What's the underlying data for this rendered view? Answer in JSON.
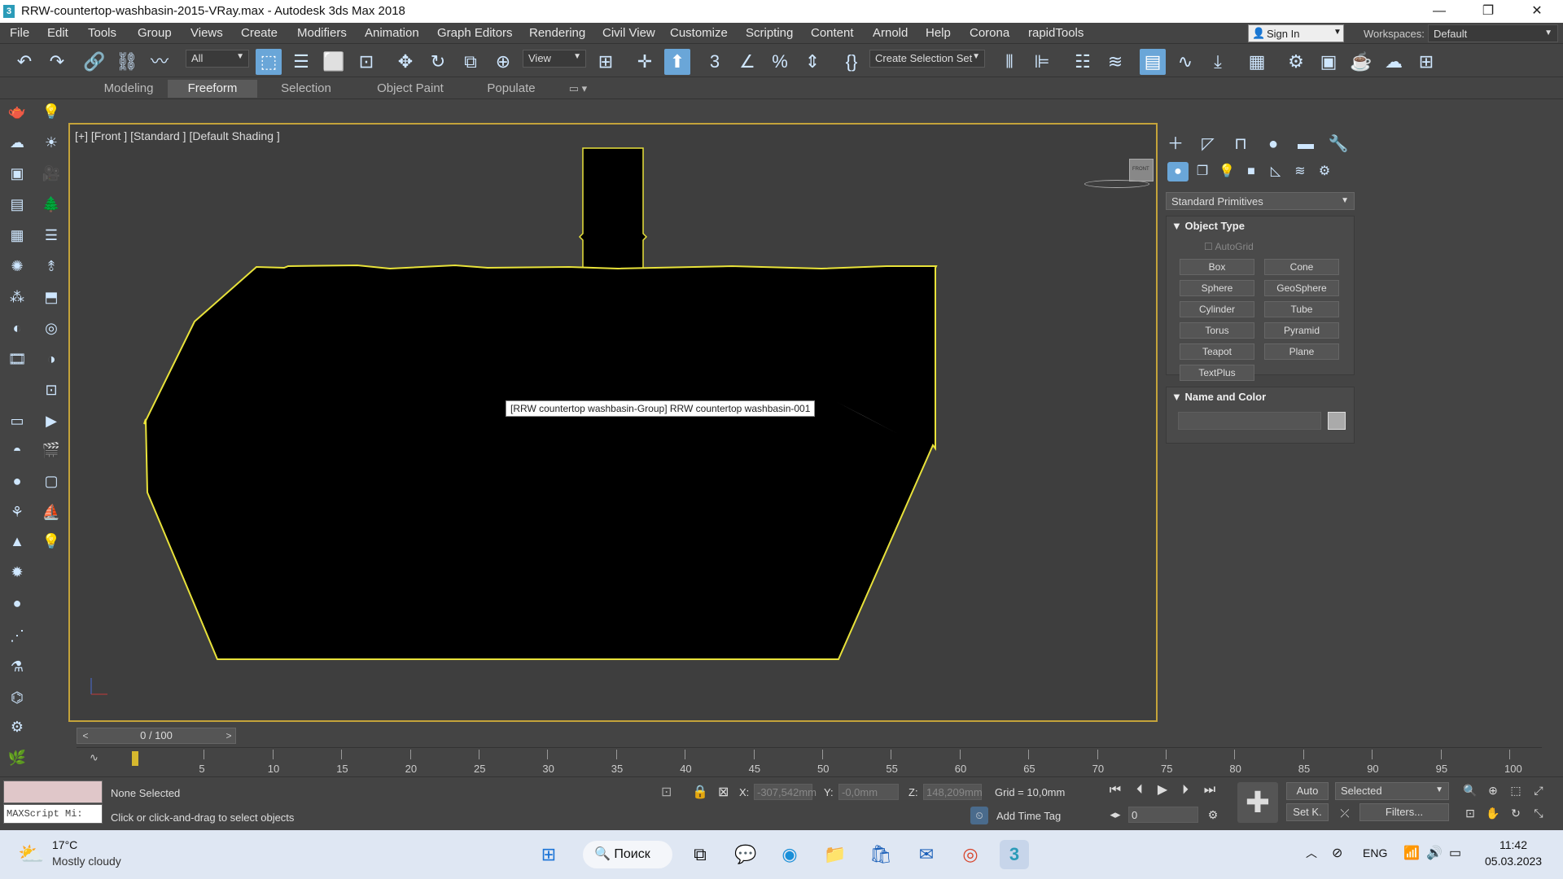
{
  "window": {
    "title": "RRW-countertop-washbasin-2015-VRay.max - Autodesk 3ds Max 2018",
    "minimize": "—",
    "maximize": "❐",
    "close": "✕"
  },
  "menu": [
    "File",
    "Edit",
    "Tools",
    "Group",
    "Views",
    "Create",
    "Modifiers",
    "Animation",
    "Graph Editors",
    "Rendering",
    "Civil View",
    "Customize",
    "Scripting",
    "Content",
    "Arnold",
    "Help",
    "Corona",
    "rapidTools"
  ],
  "signin": {
    "label": "Sign In"
  },
  "workspaces": {
    "label": "Workspaces:",
    "value": "Default"
  },
  "toolbar": {
    "filter": "All",
    "ref_coord": "View",
    "selection_set": "Create Selection Set"
  },
  "ribbon_tabs": [
    "Modeling",
    "Freeform",
    "Selection",
    "Object Paint",
    "Populate"
  ],
  "ribbon_active": "Freeform",
  "viewport": {
    "label": "[+] [Front ] [Standard ] [Default Shading ]",
    "tooltip": "[RRW countertop washbasin-Group] RRW countertop washbasin-001",
    "viewcube_label": "FRONT",
    "selection_color": "#e8e23a"
  },
  "command_panel": {
    "category": "Standard Primitives",
    "object_type_header": "Object Type",
    "autogrid": "AutoGrid",
    "primitives": [
      "Box",
      "Cone",
      "Sphere",
      "GeoSphere",
      "Cylinder",
      "Tube",
      "Torus",
      "Pyramid",
      "Teapot",
      "Plane",
      "TextPlus"
    ],
    "name_color_header": "Name and Color",
    "name_value": "",
    "color": "#aaaaaa"
  },
  "timeline": {
    "frame": "0 / 100",
    "prev": "<",
    "next": ">",
    "ticks": [
      "5",
      "10",
      "15",
      "20",
      "25",
      "30",
      "35",
      "40",
      "45",
      "50",
      "55",
      "60",
      "65",
      "70",
      "75",
      "80",
      "85",
      "90",
      "95",
      "100"
    ]
  },
  "status": {
    "maxscript": "MAXScript Mi:",
    "selection": "None Selected",
    "prompt": "Click or click-and-drag to select objects",
    "x_label": "X:",
    "x_value": "-307,542mm",
    "y_label": "Y:",
    "y_value": "-0,0mm",
    "z_label": "Z:",
    "z_value": "148,209mm",
    "grid": "Grid = 10,0mm",
    "add_time_tag": "Add Time Tag",
    "auto": "Auto",
    "set_key": "Set K.",
    "selected_dd": "Selected",
    "filters": "Filters...",
    "frame_spinner": "0"
  },
  "taskbar": {
    "temperature": "17°C",
    "weather": "Mostly cloudy",
    "search": "Поиск",
    "language": "ENG",
    "time": "11:42",
    "date": "05.03.2023"
  }
}
